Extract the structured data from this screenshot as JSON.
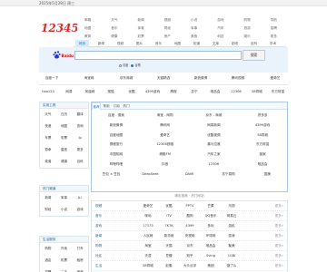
{
  "topbar": {
    "date": "2025年5月28日 周三"
  },
  "header": {
    "logo_text": "12345b",
    "links": [
      "邮箱",
      "天气",
      "新闻",
      "视频",
      "小说",
      "游戏",
      "购物",
      "导航",
      "地图",
      "音乐",
      "体育",
      "财经",
      "军事",
      "汽车",
      "旅游",
      "招聘",
      "教育",
      "健康",
      "彩票",
      "房产",
      "美食",
      "科技",
      "娱乐",
      "更多"
    ]
  },
  "search": {
    "tabs": [
      "网页",
      "新闻",
      "视频",
      "图片",
      "音乐",
      "地图",
      "知道",
      "文库",
      "贴吧",
      "百科",
      "学术"
    ],
    "active_tab": 0,
    "logo_text": "Baidu百度",
    "input_value": "",
    "button_label": "搜索",
    "radios": [
      {
        "label": "百度",
        "checked": false
      },
      {
        "label": "谷歌",
        "checked": true
      }
    ]
  },
  "sites": {
    "row1": [
      "百度一下",
      "淘宝网",
      "京东商城",
      "天猫精选",
      "新浪微博",
      "腾讯视频",
      "爱奇艺"
    ],
    "row2": [
      "hao123",
      "网易",
      "凤凰网",
      "搜狐",
      "优酷",
      "4399游戏",
      "携程",
      "苏宁",
      "唯品会",
      "12306",
      "58同城",
      "东方财富"
    ]
  },
  "sidebar": {
    "boxes": [
      {
        "title": "实用工具",
        "items": [
          "天气",
          "日历",
          "翻译",
          "快递",
          "地图",
          "查询",
          "车票",
          "彩票",
          "Ip",
          "算命",
          "星座",
          "更多",
          "菜谱",
          "健康",
          "百科"
        ]
      },
      {
        "title": "热门频道",
        "items": [
          "新闻",
          "军事",
          "A.I",
          "财经",
          "小说",
          "游戏"
        ]
      },
      {
        "title": "生活服务",
        "items": [
          "购物",
          "外卖",
          "打车",
          "酒店",
          "机票",
          "租房",
          "招聘",
          "二手",
          "家政"
        ]
      }
    ]
  },
  "main": {
    "tabs": [
      "推荐",
      "常用",
      "订阅",
      "热门"
    ],
    "rows": [
      [
        "百度 - 搜索",
        "淘宝 - 网购",
        "京东 - 商城",
        "拼多多"
      ],
      [
        "新浪微博",
        "腾讯网",
        "网易新闻",
        "4399游戏"
      ],
      [
        "百度地图",
        "爱奇艺",
        "优酷视频",
        "58同城"
      ],
      [
        "携程旅行",
        "12306铁路",
        "喜马拉雅",
        "东方财富"
      ],
      [
        "中国知网",
        "蜻蜓FM",
        "汽车之家",
        "链家"
      ],
      [
        "哔哩哔哩",
        "抖音",
        "12306",
        "唯品会"
      ],
      [
        "豆包 × 豆包",
        "DeepSeek",
        "DAMI",
        "苏宁易购",
        "国美"
      ]
    ]
  },
  "bottom": {
    "title": "精彩推荐 · 热门网站",
    "rows": [
      {
        "cat": "视频",
        "sites": [
          "爱奇艺",
          "优酷",
          "PPTV",
          "芒果",
          "乐视"
        ],
        "more": "更多»"
      },
      {
        "cat": "音乐",
        "sites": [
          "咪咕",
          "iTV",
          "酷狗",
          "QQ音乐",
          "网易云"
        ],
        "more": "更多»"
      },
      {
        "cat": "游戏",
        "sites": [
          "17173",
          "7K7K",
          "4399",
          "多玩",
          "游民"
        ],
        "more": "更多»"
      },
      {
        "cat": "新闻",
        "sites": [
          "人民网",
          "新华网",
          "央视网",
          "环球网",
          "澎湃"
        ],
        "more": "更多»"
      },
      {
        "cat": "购物",
        "sites": [
          "淘宝",
          "天猫",
          "京东",
          "唯品会",
          "聚美"
        ],
        "more": "更多»"
      },
      {
        "cat": "社区",
        "sites": [
          "天涯",
          "豆瓣",
          "知乎",
          "Sving",
          "1GBI"
        ],
        "more": "更多»"
      },
      {
        "cat": "生活",
        "sites": [
          "58同城",
          "赶集",
          "大众点评",
          "美团",
          "饿了么"
        ],
        "more": "更多»"
      }
    ]
  },
  "colors": {
    "accent": "#1d6fc6",
    "logo_red": "#d72d2d",
    "baidu_blue": "#2932e1",
    "baidu_red": "#e10602"
  },
  "icons": [
    "baidu-logo-icon",
    "site-logo-icon"
  ]
}
